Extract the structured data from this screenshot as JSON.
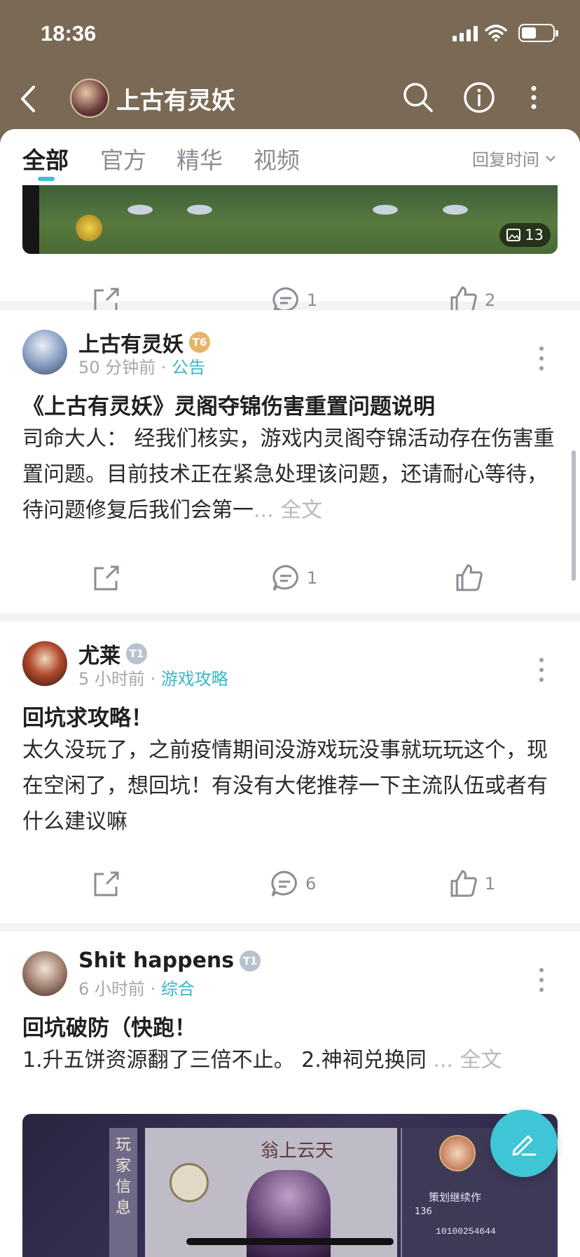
{
  "status": {
    "time": "18:36"
  },
  "header": {
    "title": "上古有灵妖"
  },
  "tabs": [
    "全部",
    "官方",
    "精华",
    "视频"
  ],
  "sort_label": "回复时间",
  "colors": {
    "accent": "#3ec5d6",
    "header_bg": "#7a6a55"
  },
  "posts": [
    {
      "image_count": "13",
      "stats": {
        "comments": "1",
        "likes": "2"
      }
    },
    {
      "author": "上古有灵妖",
      "level": "T6",
      "time": "50 分钟前",
      "category": "公告",
      "title": "《上古有灵妖》灵阁夺锦伤害重置问题说明",
      "body": "司命大人： 经我们核实，游戏内灵阁夺锦活动存在伤害重置问题。目前技术正在紧急处理该问题，还请耐心等待，待问题修复后我们会第一",
      "more": "... 全文",
      "stats": {
        "comments": "1",
        "likes": ""
      }
    },
    {
      "author": "尤莱",
      "level": "T1",
      "time": "5 小时前",
      "category": "游戏攻略",
      "title": "回坑求攻略！",
      "body": "太久没玩了，之前疫情期间没游戏玩没事就玩玩这个，现在空闲了，想回坑！有没有大佬推荐一下主流队伍或者有什么建议嘛",
      "stats": {
        "comments": "6",
        "likes": "1"
      }
    },
    {
      "author": "Shit happens",
      "level": "T1",
      "time": "6 小时前",
      "category": "综合",
      "title": "回坑破防（快跑！",
      "body": "1.升五饼资源翻了三倍不止。 2.神祠兑换同",
      "more": "... 全文",
      "image_text": {
        "side_label": "玩家信息",
        "game_logo": "翁上云天",
        "player_id": "10100254644",
        "role": "策划继续作",
        "level": "136"
      }
    }
  ]
}
